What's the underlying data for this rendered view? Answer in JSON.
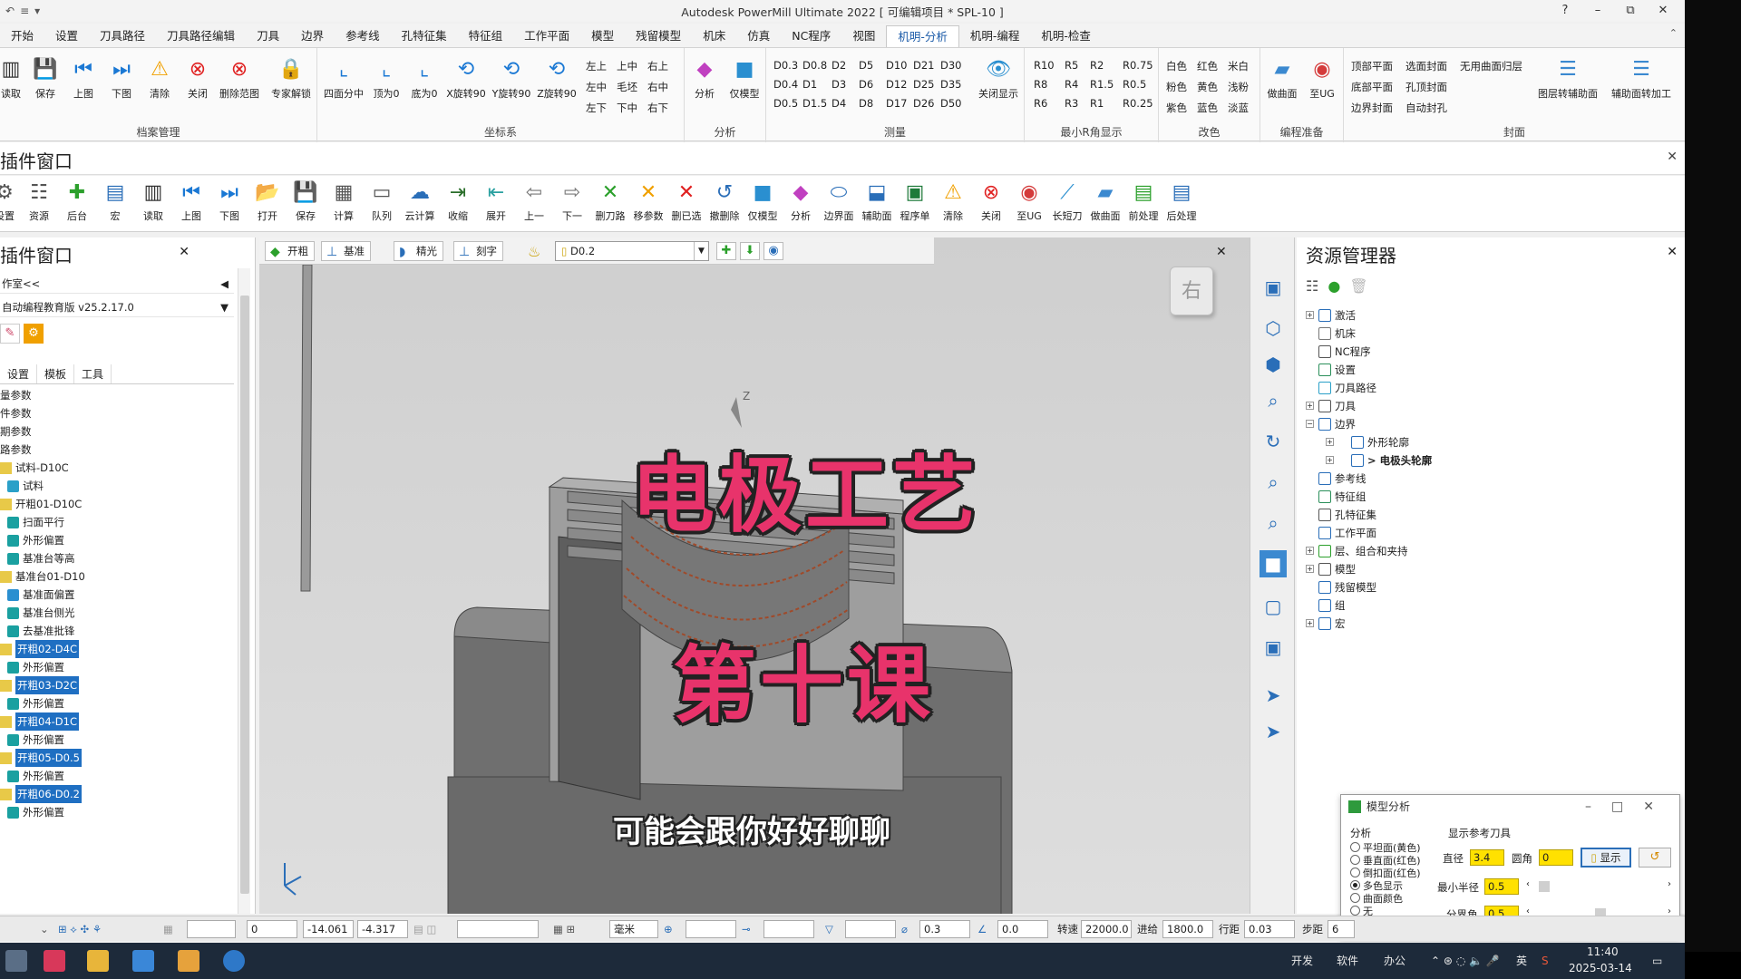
{
  "titlebar": {
    "quick": [
      "↶",
      "≡",
      "▾"
    ],
    "title": "Autodesk PowerMill Ultimate 2022    [ 可编辑项目 * SPL-10 ]",
    "controls": [
      "?",
      "–",
      "⧉",
      "✕"
    ]
  },
  "tabs": [
    "开始",
    "设置",
    "刀具路径",
    "刀具路径编辑",
    "刀具",
    "边界",
    "参考线",
    "孔特征集",
    "特征组",
    "工作平面",
    "模型",
    "残留模型",
    "机床",
    "仿真",
    "NC程序",
    "视图",
    "机明-分析",
    "机明-编程",
    "机明-检查"
  ],
  "active_tab": "机明-分析",
  "ribbon": {
    "archive": {
      "label": "档案管理",
      "buttons": [
        "读取",
        "保存",
        "上图",
        "下图",
        "清除",
        "关闭",
        "删除范图",
        "专家解锁"
      ]
    },
    "coords": {
      "label": "坐标系",
      "buttons": [
        "四面分中",
        "顶为0",
        "底为0",
        "X旋转90",
        "Y旋转90",
        "Z旋转90"
      ],
      "grid": [
        "左上",
        "上中",
        "右上",
        "左中",
        "毛坯",
        "右中",
        "左下",
        "下中",
        "右下"
      ]
    },
    "analysis": {
      "label": "分析",
      "buttons": [
        "分析",
        "仅模型"
      ]
    },
    "measure": {
      "label": "测量",
      "grid": [
        "D0.3",
        "D0.8",
        "D2",
        "D5",
        "D10",
        "D21",
        "D30",
        "D0.4",
        "D1",
        "D3",
        "D6",
        "D12",
        "D25",
        "D35",
        "D0.5",
        "D1.5",
        "D4",
        "D8",
        "D17",
        "D26",
        "D50"
      ],
      "button": "关闭显示"
    },
    "minr": {
      "label": "最小R角显示",
      "grid": [
        "R10",
        "R5",
        "R2",
        "R0.75",
        "R8",
        "R4",
        "R1.5",
        "R0.5",
        "R6",
        "R3",
        "R1",
        "R0.25"
      ]
    },
    "color": {
      "label": "改色",
      "grid": [
        "白色",
        "红色",
        "米白",
        "粉色",
        "黄色",
        "浅粉",
        "紫色",
        "蓝色",
        "淡蓝"
      ]
    },
    "prep": {
      "label": "编程准备",
      "buttons": [
        "做曲面",
        "至UG"
      ]
    },
    "seal": {
      "label": "封面",
      "grid": [
        "顶部平面",
        "选面封面",
        "无用曲面归层",
        "底部平面",
        "孔顶封面",
        "边界封面",
        "自动封孔"
      ],
      "buttons": [
        "图层转辅助面",
        "辅助面转加工"
      ]
    }
  },
  "panel1_title": "插件窗口",
  "toolbar2": [
    "设置",
    "资源",
    "后台",
    "宏",
    "读取",
    "上图",
    "下图",
    "打开",
    "保存",
    "计算",
    "队列",
    "云计算",
    "收缩",
    "展开",
    "上一",
    "下一",
    "删刀路",
    "移参数",
    "删已选",
    "撤删除",
    "仅模型",
    "分析",
    "边界面",
    "辅助面",
    "程序单",
    "清除",
    "关闭",
    "至UG",
    "长短刀",
    "做曲面",
    "前处理",
    "后处理"
  ],
  "left": {
    "title": "插件窗口",
    "row1": "作室<<",
    "row2": "自动编程教育版 v25.2.17.0",
    "tabs": [
      "设置",
      "模板",
      "工具"
    ],
    "tree": [
      {
        "t": "量参数",
        "c": ""
      },
      {
        "t": "件参数",
        "c": ""
      },
      {
        "t": "期参数",
        "c": ""
      },
      {
        "t": "路参数",
        "c": ""
      },
      {
        "t": "试料-D10C",
        "c": "#e8c948"
      },
      {
        "t": "试料",
        "c": "#2aa0c8",
        "i": 1
      },
      {
        "t": "开粗01-D10C",
        "c": "#e8c948"
      },
      {
        "t": "扫面平行",
        "c": "#1aa0a0",
        "i": 1
      },
      {
        "t": "外形偏置",
        "c": "#1aa0a0",
        "i": 1
      },
      {
        "t": "基准台等高",
        "c": "#1aa0a0",
        "i": 1
      },
      {
        "t": "基准台01-D10",
        "c": "#e8c948"
      },
      {
        "t": "基准面偏置",
        "c": "#2a8fd0",
        "i": 1
      },
      {
        "t": "基准台侧光",
        "c": "#1aa0a0",
        "i": 1
      },
      {
        "t": "去基准批锋",
        "c": "#1aa0a0",
        "i": 1
      },
      {
        "t": "开粗02-D4C",
        "c": "#e8c948",
        "sel": 1
      },
      {
        "t": "外形偏置",
        "c": "#1aa0a0",
        "i": 1
      },
      {
        "t": "开粗03-D2C",
        "c": "#e8c948",
        "sel": 1
      },
      {
        "t": "外形偏置",
        "c": "#1aa0a0",
        "i": 1
      },
      {
        "t": "开粗04-D1C",
        "c": "#e8c948",
        "sel": 1
      },
      {
        "t": "外形偏置",
        "c": "#1aa0a0",
        "i": 1
      },
      {
        "t": "开粗05-D0.5",
        "c": "#e8c948",
        "sel": 1
      },
      {
        "t": "外形偏置",
        "c": "#1aa0a0",
        "i": 1
      },
      {
        "t": "开粗06-D0.2",
        "c": "#e8c948",
        "sel": 1
      },
      {
        "t": "外形偏置",
        "c": "#1aa0a0",
        "i": 1
      }
    ]
  },
  "viewport": {
    "buttons": [
      "开粗",
      "基准",
      "精光",
      "刻字"
    ],
    "tool_select": "D0.2",
    "view_cube": "右",
    "axis_label": "Z",
    "overlay_title": "电极工艺",
    "overlay_lesson": "第十课",
    "subtitle": "可能会跟你好好聊聊"
  },
  "explorer": {
    "title": "资源管理器",
    "items": [
      {
        "t": "激活",
        "lvl": 0,
        "pl": "+"
      },
      {
        "t": "机床",
        "lvl": 0
      },
      {
        "t": "NC程序",
        "lvl": 0
      },
      {
        "t": "设置",
        "lvl": 0
      },
      {
        "t": "刀具路径",
        "lvl": 0
      },
      {
        "t": "刀具",
        "lvl": 0,
        "pl": "+"
      },
      {
        "t": "边界",
        "lvl": 0,
        "pl": "−"
      },
      {
        "t": "外形轮廓",
        "lvl": 1,
        "pl": "+"
      },
      {
        "t": "> 电极头轮廓",
        "lvl": 1,
        "pl": "+",
        "b": 1
      },
      {
        "t": "参考线",
        "lvl": 0
      },
      {
        "t": "特征组",
        "lvl": 0
      },
      {
        "t": "孔特征集",
        "lvl": 0
      },
      {
        "t": "工作平面",
        "lvl": 0
      },
      {
        "t": "层、组合和夹持",
        "lvl": 0,
        "pl": "+"
      },
      {
        "t": "模型",
        "lvl": 0,
        "pl": "+"
      },
      {
        "t": "残留模型",
        "lvl": 0
      },
      {
        "t": "组",
        "lvl": 0
      },
      {
        "t": "宏",
        "lvl": 0,
        "pl": "+"
      }
    ]
  },
  "dialog": {
    "title": "模型分析",
    "analysis_label": "分析",
    "options": [
      "平坦面(黄色)",
      "垂直面(红色)",
      "倒扣面(红色)",
      "多色显示",
      "曲面颜色",
      "无"
    ],
    "selected": "多色显示",
    "ref_label": "显示参考刀具",
    "diameter_label": "直径",
    "diameter": "3.4",
    "corner_label": "圆角",
    "corner": "0",
    "show_btn": "显示",
    "minr_label": "最小半径",
    "minr": "0.5",
    "angle_label": "分界角",
    "angle": "0.5"
  },
  "status": {
    "x": "0",
    "y": "-14.061",
    "z": "-4.317",
    "unit": "毫米",
    "dia": "0.3",
    "ang": "0.0",
    "speed_label": "转速",
    "speed": "22000.0",
    "feed_label": "进给",
    "feed": "1800.0",
    "step_label": "行距",
    "step": "0.03",
    "stepdown_label": "步距",
    "stepdown": "6"
  },
  "taskbar": {
    "tray": [
      "开发",
      "软件",
      "办公"
    ],
    "time": "11:40",
    "date": "2025-03-14",
    "ime": "英"
  }
}
